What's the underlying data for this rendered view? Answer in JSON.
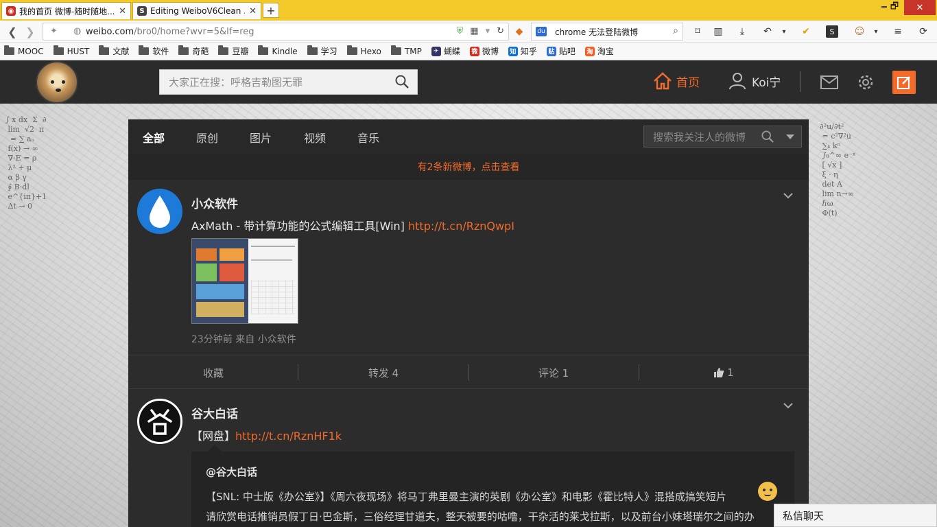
{
  "browser": {
    "tabs": [
      {
        "title": "我的首页 微博-随时随地...",
        "active": true
      },
      {
        "title": "Editing WeiboV6Clean ...",
        "active": false
      }
    ],
    "new_tab": "+",
    "window_controls": {
      "minimize": "🗕",
      "restore": "🗗",
      "close": "✕"
    },
    "url_host": "weibo.com",
    "url_path": "/bro0/home?wvr=5&lf=reg",
    "search_text": "chrome 无法登陆微博",
    "bookmarks": [
      {
        "label": "MOOC",
        "type": "folder"
      },
      {
        "label": "HUST",
        "type": "folder"
      },
      {
        "label": "文献",
        "type": "folder"
      },
      {
        "label": "软件",
        "type": "folder"
      },
      {
        "label": "奇葩",
        "type": "folder"
      },
      {
        "label": "豆瓣",
        "type": "folder"
      },
      {
        "label": "Kindle",
        "type": "folder"
      },
      {
        "label": "学习",
        "type": "folder"
      },
      {
        "label": "Hexo",
        "type": "folder"
      },
      {
        "label": "TMP",
        "type": "folder"
      },
      {
        "label": "蝴蝶",
        "type": "site",
        "color": "#333366",
        "glyph": "✈"
      },
      {
        "label": "微博",
        "type": "site",
        "color": "#d52b1e",
        "glyph": "微"
      },
      {
        "label": "知乎",
        "type": "site",
        "color": "#0f6fd4",
        "glyph": "知"
      },
      {
        "label": "贴吧",
        "type": "site",
        "color": "#2c6cd8",
        "glyph": "贴"
      },
      {
        "label": "淘宝",
        "type": "site",
        "color": "#f55b23",
        "glyph": "淘"
      }
    ]
  },
  "weibo": {
    "search_placeholder": "大家正在搜：呼格吉勒图无罪",
    "home_label": "首页",
    "user_label": "Koi宁",
    "feed_tabs": [
      "全部",
      "原创",
      "图片",
      "视频",
      "音乐"
    ],
    "feed_search_placeholder": "搜索我关注人的微博",
    "new_posts": "有2条新微博，点击查看",
    "posts": [
      {
        "author": "小众软件",
        "text": "AxMath - 带计算功能的公式编辑工具[Win] ",
        "link": "http://t.cn/RznQwpI",
        "meta": "23分钟前 来自 小众软件",
        "actions": {
          "favorite": "收藏",
          "repost": "转发 4",
          "comment": "评论 1",
          "like": "1"
        }
      },
      {
        "author": "谷大白话",
        "text": "【网盘】",
        "link": "http://t.cn/RznHF1k",
        "repost_author": "@谷大白话",
        "repost_line1": "【SNL: 中士版《办公室》】《周六夜现场》将马丁弗里曼主演的英剧《办公室》和电影《霍比特人》混搭成搞笑短片",
        "repost_line2": "请欣赏电话推销员假丁日·巴金斯，三俗经理甘道夫，整天被要的咕噜，干杂活的莱戈拉斯，以及前台小妹塔瑞尔之间的办"
      }
    ],
    "chat_label": "私信聊天",
    "colors": {
      "accent": "#f26b2a",
      "feed_bg": "#2c2c2c",
      "nav_bg": "#2b2b2b"
    }
  }
}
